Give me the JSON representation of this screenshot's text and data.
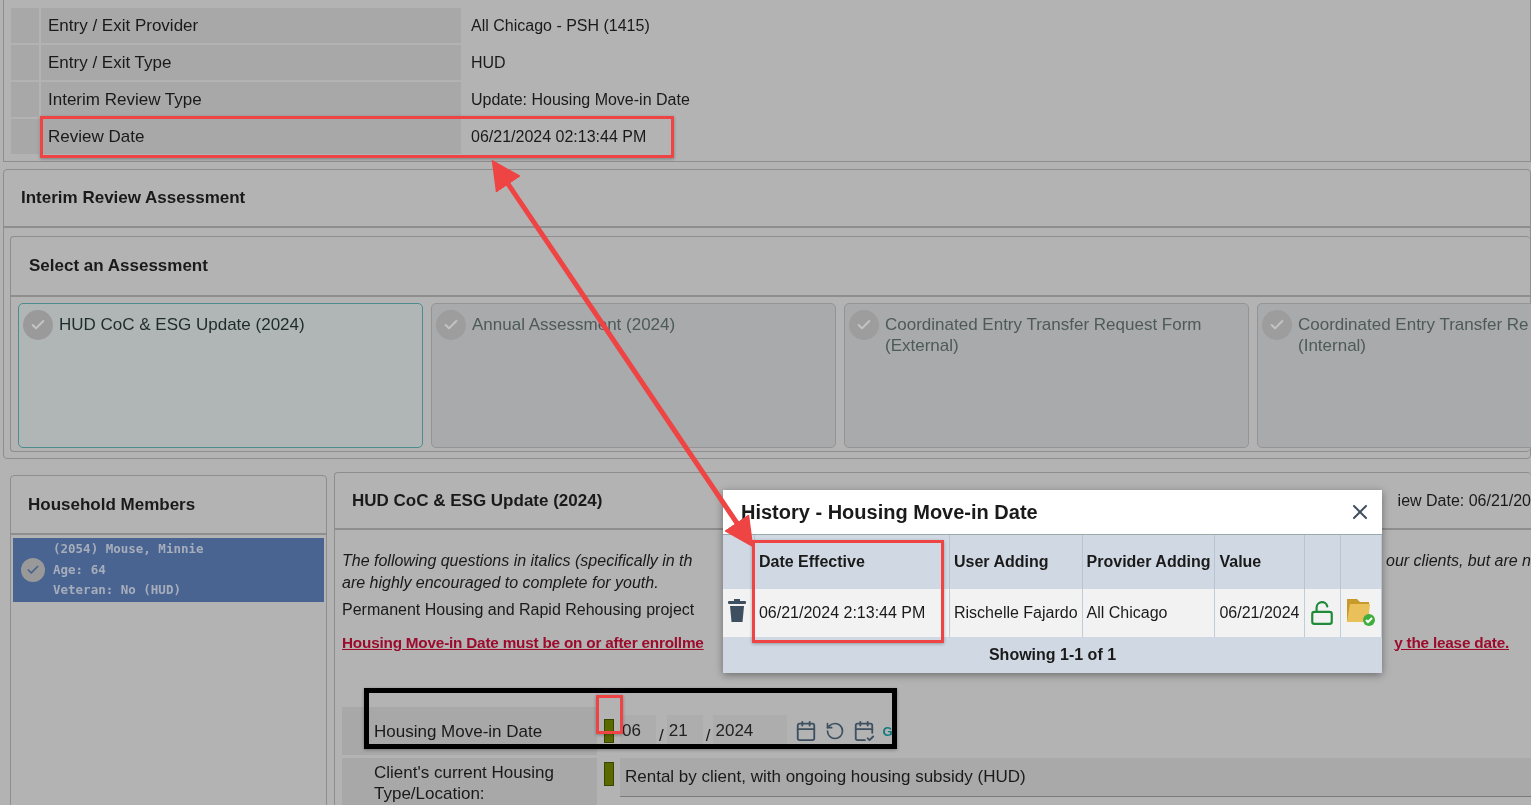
{
  "info_rows": [
    {
      "label": "Entry / Exit Provider",
      "value": "All Chicago - PSH (1415)"
    },
    {
      "label": "Entry / Exit Type",
      "value": "HUD"
    },
    {
      "label": "Interim Review Type",
      "value": "Update: Housing Move-in Date"
    },
    {
      "label": "Review Date",
      "value": "06/21/2024 02:13:44 PM"
    }
  ],
  "interim_panel": {
    "title": "Interim Review Assessment",
    "select_title": "Select an Assessment",
    "assessments": [
      {
        "lines": [
          "HUD CoC & ESG Update (2024)"
        ],
        "selected": true
      },
      {
        "lines": [
          "Annual Assessment (2024)"
        ],
        "selected": false
      },
      {
        "lines": [
          "Coordinated Entry Transfer Request Form",
          "(External)"
        ],
        "selected": false
      },
      {
        "lines": [
          "Coordinated Entry Transfer Re",
          "(Internal)"
        ],
        "selected": false
      }
    ]
  },
  "household": {
    "title": "Household Members",
    "members": [
      {
        "lines": [
          "(2054) Mouse, Minnie",
          "Age: 64",
          "Veteran: No (HUD)"
        ],
        "selected": true
      }
    ]
  },
  "assessment_form": {
    "title": "HUD CoC & ESG Update (2024)",
    "header_right": "iew Date: 06/21/20",
    "paragraph_lines": [
      {
        "kind": "italic",
        "left": "The following questions in italics (specifically in th",
        "right": "our clients, but are n"
      },
      {
        "kind": "italic",
        "left": "are highly encouraged to complete for youth."
      },
      {
        "kind": "plain",
        "left": "Permanent Housing and Rapid Rehousing project"
      },
      {
        "kind": "warning",
        "left": "Housing Move-in Date must be on or after enrollme",
        "right": "y the lease date."
      }
    ],
    "fields": [
      {
        "kind": "date",
        "label": "Housing Move-in Date",
        "month": "06",
        "separator": "/",
        "day": "21",
        "year": "2024",
        "action": "G"
      },
      {
        "kind": "select",
        "label": "Client's current Housing Type/Location:",
        "value": "Rental by client, with ongoing housing subsidy (HUD)"
      }
    ]
  },
  "history_dialog": {
    "title": "History - Housing Move-in Date",
    "columns": [
      "Date Effective",
      "User Adding",
      "Provider Adding",
      "Value"
    ],
    "rows": [
      {
        "cells": [
          "06/21/2024 2:13:44 PM",
          "Rischelle Fajardo",
          "All Chicago",
          "06/21/2024"
        ]
      }
    ],
    "footer": "Showing 1-1 of 1"
  }
}
